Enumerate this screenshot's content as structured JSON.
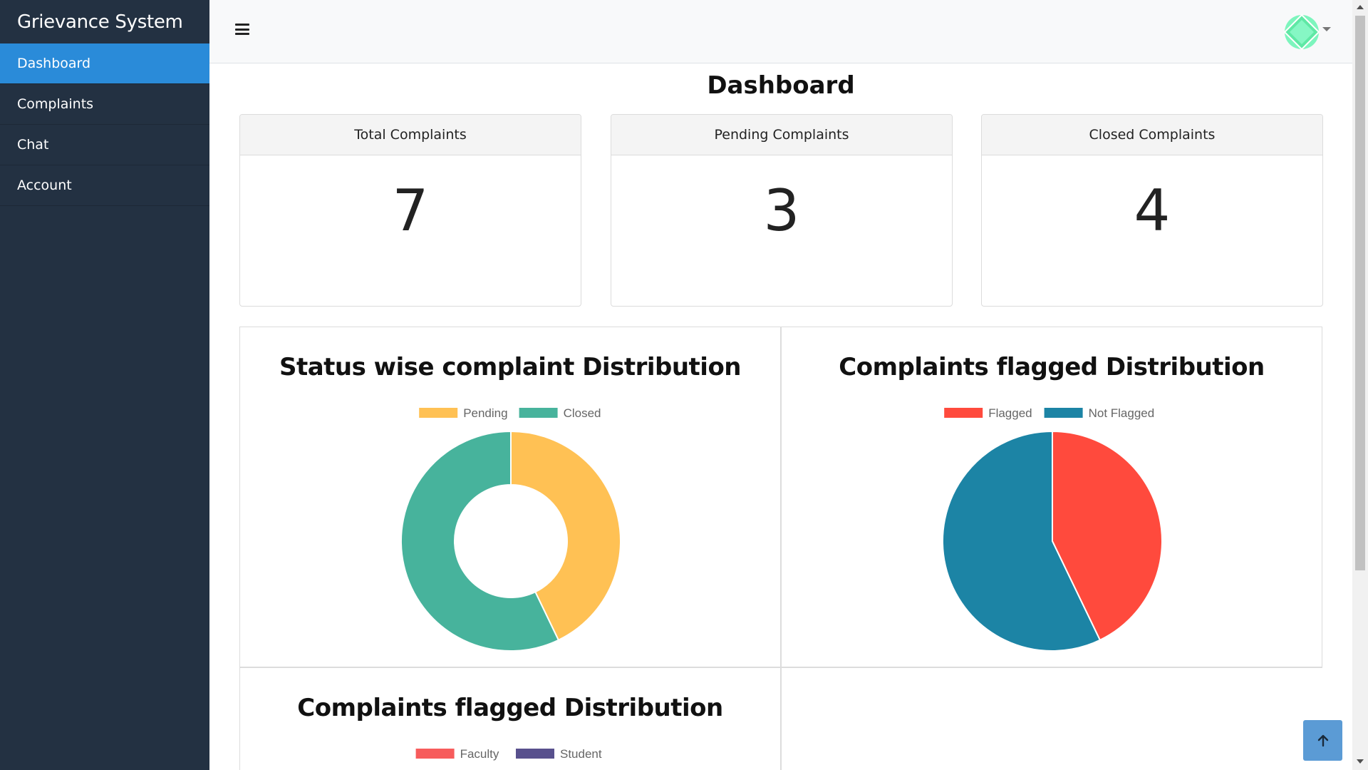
{
  "app": {
    "title": "Grievance System"
  },
  "sidebar": {
    "items": [
      {
        "label": "Dashboard",
        "active": true
      },
      {
        "label": "Complaints",
        "active": false
      },
      {
        "label": "Chat",
        "active": false
      },
      {
        "label": "Account",
        "active": false
      }
    ]
  },
  "topbar": {
    "menu_icon": "hamburger-icon",
    "avatar_icon": "avatar-icon",
    "dropdown_icon": "caret-down-icon"
  },
  "page": {
    "title": "Dashboard"
  },
  "stats": [
    {
      "label": "Total Complaints",
      "value": "7"
    },
    {
      "label": "Pending Complaints",
      "value": "3"
    },
    {
      "label": "Closed Complaints",
      "value": "4"
    }
  ],
  "colors": {
    "sidebar_bg": "#233142",
    "active_nav": "#2a8bd9",
    "pending": "#ffc154",
    "closed": "#47b39c",
    "flagged": "#ff4a3d",
    "not_flagged": "#1c84a5",
    "faculty": "#f75c5c",
    "student": "#58508d",
    "back_to_top": "#5b9bd5"
  },
  "chart_data": [
    {
      "type": "pie",
      "variant": "doughnut",
      "title": "Status wise complaint Distribution",
      "categories": [
        "Pending",
        "Closed"
      ],
      "values": [
        3,
        4
      ],
      "colors": [
        "#ffc154",
        "#47b39c"
      ],
      "legend": "top"
    },
    {
      "type": "pie",
      "title": "Complaints flagged Distribution",
      "categories": [
        "Flagged",
        "Not Flagged"
      ],
      "values": [
        3,
        4
      ],
      "colors": [
        "#ff4a3d",
        "#1c84a5"
      ],
      "legend": "top"
    },
    {
      "type": "pie",
      "title": "Complaints flagged Distribution",
      "categories": [
        "Faculty",
        "Student"
      ],
      "colors": [
        "#f75c5c",
        "#58508d"
      ],
      "legend": "top"
    }
  ],
  "back_to_top": {
    "icon": "arrow-up-icon"
  }
}
